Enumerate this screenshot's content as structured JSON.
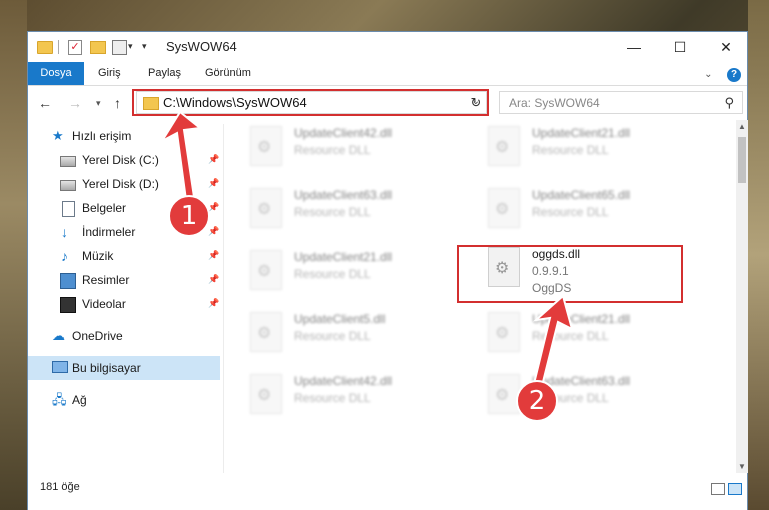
{
  "window": {
    "title": "SysWOW64"
  },
  "ribbon": {
    "tabs": [
      "Dosya",
      "Giriş",
      "Paylaş",
      "Görünüm"
    ]
  },
  "address": {
    "path": "C:\\Windows\\SysWOW64"
  },
  "search": {
    "placeholder": "Ara: SysWOW64"
  },
  "sidebar": {
    "items": [
      {
        "label": "Hızlı erişim",
        "icon": "star-icon"
      },
      {
        "label": "Yerel Disk (C:)",
        "icon": "drive-icon",
        "pinned": true
      },
      {
        "label": "Yerel Disk (D:)",
        "icon": "drive-icon",
        "pinned": true
      },
      {
        "label": "Belgeler",
        "icon": "document-icon",
        "pinned": true
      },
      {
        "label": "İndirmeler",
        "icon": "download-icon",
        "pinned": true
      },
      {
        "label": "Müzik",
        "icon": "music-icon",
        "pinned": true
      },
      {
        "label": "Resimler",
        "icon": "pictures-icon",
        "pinned": true
      },
      {
        "label": "Videolar",
        "icon": "video-icon",
        "pinned": true
      },
      {
        "label": "OneDrive",
        "icon": "cloud-icon"
      },
      {
        "label": "Bu bilgisayar",
        "icon": "computer-icon",
        "selected": true
      },
      {
        "label": "Ağ",
        "icon": "network-icon"
      }
    ]
  },
  "files": [
    {
      "name": "UpdateClient42.dll",
      "type": "Resource DLL"
    },
    {
      "name": "UpdateClient21.dll",
      "type": "Resource DLL"
    },
    {
      "name": "UpdateClient63.dll",
      "type": "Resource DLL"
    },
    {
      "name": "UpdateClient65.dll",
      "type": "Resource DLL"
    },
    {
      "name": "UpdateClient21.dll",
      "type": "Resource DLL"
    },
    {
      "name": "oggds.dll",
      "version": "0.9.9.1",
      "description": "OggDS"
    },
    {
      "name": "UpdateClient5.dll",
      "type": "Resource DLL"
    },
    {
      "name": "UpdateClient21.dll",
      "type": "Resource DLL"
    },
    {
      "name": "UpdateClient42.dll",
      "type": "Resource DLL"
    },
    {
      "name": "UpdateClient63.dll",
      "type": "Resource DLL"
    }
  ],
  "status": {
    "item_count": "181 öğe"
  },
  "annotations": {
    "step1": "1",
    "step2": "2"
  },
  "colors": {
    "accent": "#1979ca",
    "highlight": "#d32f2f"
  }
}
